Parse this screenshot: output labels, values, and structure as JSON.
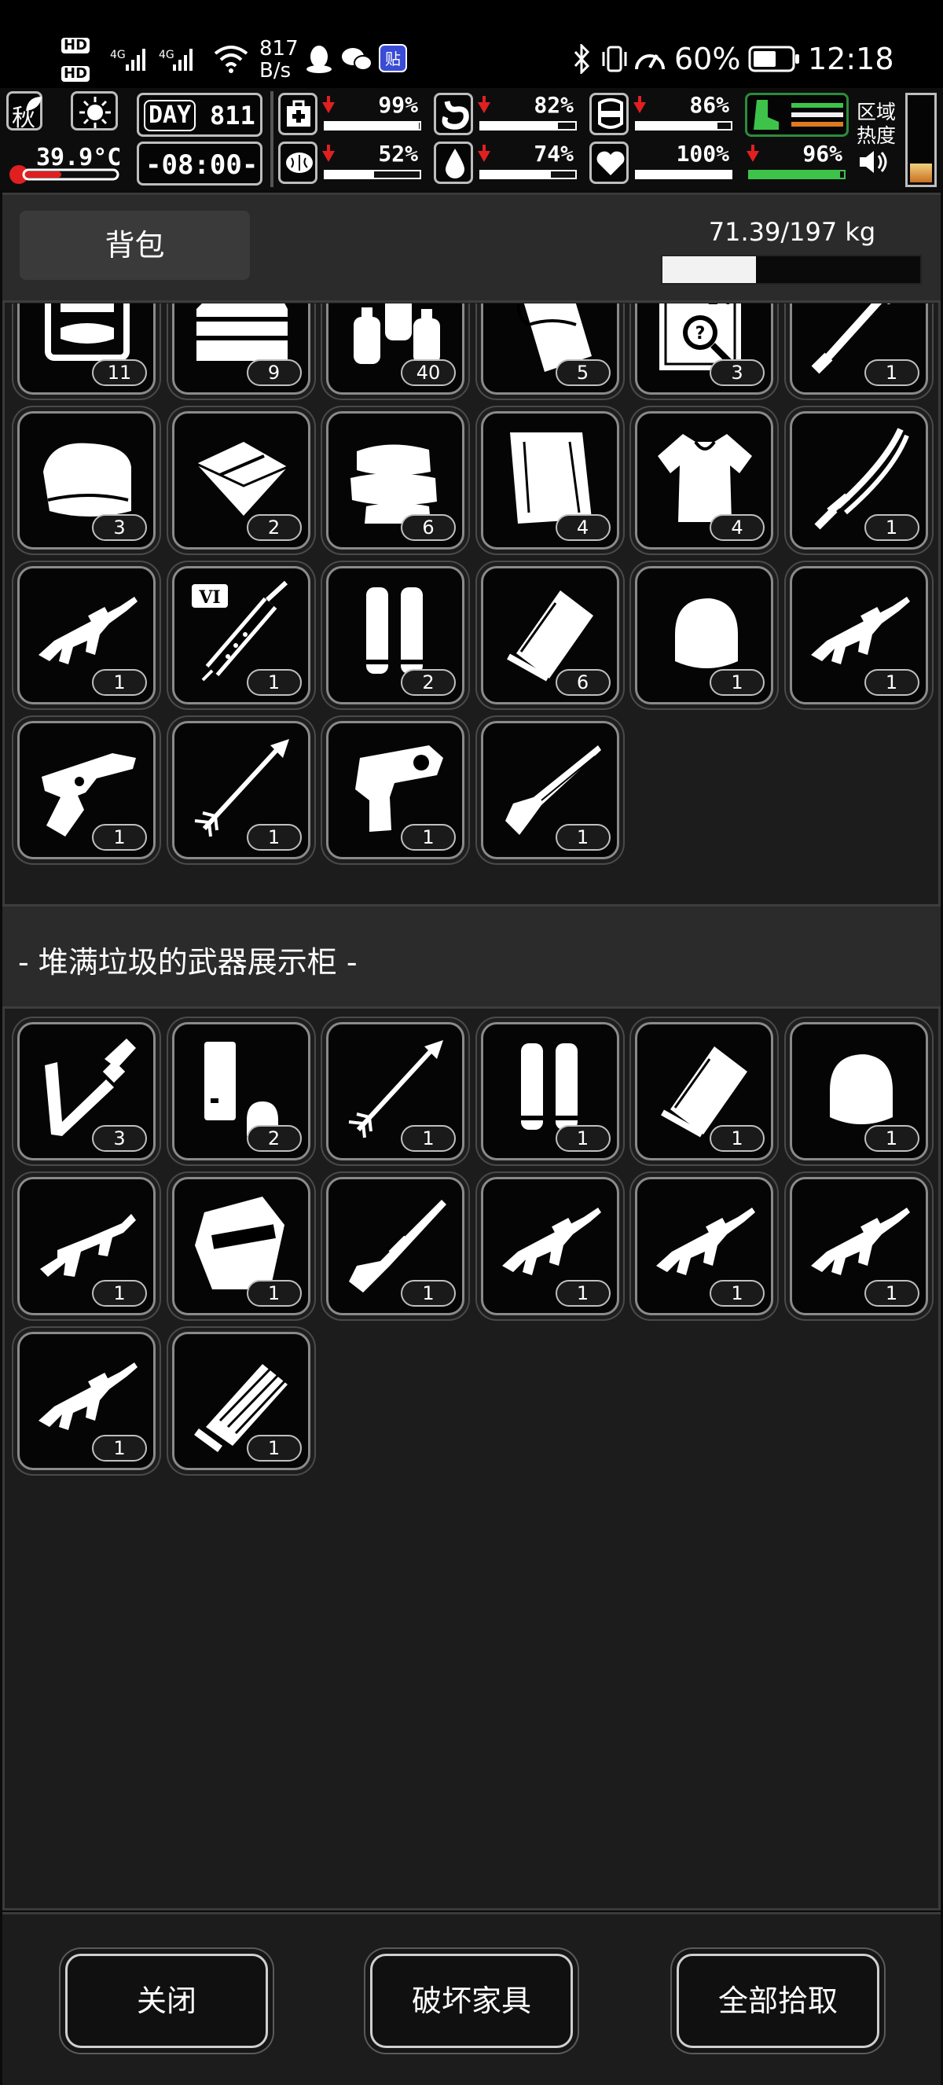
{
  "status_bar": {
    "hd1": "HD",
    "hd2": "HD",
    "net_speed_value": "817",
    "net_speed_unit": "B/s",
    "battery_pct": "60%",
    "time": "12:18"
  },
  "hud": {
    "season": "秋",
    "temperature": "39.9°C",
    "day_label": "DAY",
    "day_number": "811",
    "clock": "-08:00-",
    "region_heat_line1": "区域",
    "region_heat_line2": "热度",
    "stats": [
      {
        "name": "health",
        "icon": "medkit-icon",
        "value": "99%",
        "fraction": 0.99
      },
      {
        "name": "hunger",
        "icon": "stomach-icon",
        "value": "82%",
        "fraction": 0.82
      },
      {
        "name": "armor",
        "icon": "armor-icon",
        "value": "86%",
        "fraction": 0.86
      },
      {
        "name": "sanity",
        "icon": "brain-icon",
        "value": "52%",
        "fraction": 0.52
      },
      {
        "name": "thirst",
        "icon": "water-drop-icon",
        "value": "74%",
        "fraction": 0.74
      },
      {
        "name": "mood",
        "icon": "heart-icon",
        "value": "100%",
        "fraction": 1.0
      },
      {
        "name": "stamina",
        "icon": "boot-icon",
        "value": "96%",
        "fraction": 0.96
      }
    ]
  },
  "backpack": {
    "tab_label": "背包",
    "weight": "71.39/197 kg",
    "weight_fraction": 0.3624,
    "items": [
      {
        "icon": "toolkit-icon",
        "qty": "11"
      },
      {
        "icon": "toolbox-icon",
        "qty": "9"
      },
      {
        "icon": "spray-cans-icon",
        "qty": "40"
      },
      {
        "icon": "paper-roll-icon",
        "qty": "5"
      },
      {
        "icon": "manual-book-iv-icon",
        "qty": "3"
      },
      {
        "icon": "shovel-icon",
        "qty": "1"
      },
      {
        "icon": "blanket-icon",
        "qty": "3"
      },
      {
        "icon": "cloth-icon",
        "qty": "2"
      },
      {
        "icon": "clothes-pile-icon",
        "qty": "6"
      },
      {
        "icon": "towel-icon",
        "qty": "4"
      },
      {
        "icon": "shirt-icon",
        "qty": "4"
      },
      {
        "icon": "katana-icon",
        "qty": "1"
      },
      {
        "icon": "assault-rifle-icon",
        "qty": "1"
      },
      {
        "icon": "syringe-vi-icon",
        "qty": "1"
      },
      {
        "icon": "cartridges-icon",
        "qty": "2"
      },
      {
        "icon": "bullet-pack-icon",
        "qty": "6"
      },
      {
        "icon": "bullet-icon",
        "qty": "1"
      },
      {
        "icon": "assault-rifle-icon",
        "qty": "1"
      },
      {
        "icon": "revolver-icon",
        "qty": "1"
      },
      {
        "icon": "arrow-icon",
        "qty": "1"
      },
      {
        "icon": "flare-gun-icon",
        "qty": "1"
      },
      {
        "icon": "shotgun-icon",
        "qty": "1"
      }
    ]
  },
  "container": {
    "title": "- 堆满垃圾的武器展示柜 -",
    "items": [
      {
        "icon": "crowbar-bolt-icon",
        "qty": "3"
      },
      {
        "icon": "magazine-icon",
        "qty": "2"
      },
      {
        "icon": "arrow-icon",
        "qty": "1"
      },
      {
        "icon": "cartridges-icon",
        "qty": "1"
      },
      {
        "icon": "bullet-pack-icon",
        "qty": "1"
      },
      {
        "icon": "bullet-icon",
        "qty": "1"
      },
      {
        "icon": "smg-icon",
        "qty": "1"
      },
      {
        "icon": "riot-shield-icon",
        "qty": "1"
      },
      {
        "icon": "hunting-rifle-icon",
        "qty": "1"
      },
      {
        "icon": "assault-rifle-icon",
        "qty": "1"
      },
      {
        "icon": "assault-rifle-icon",
        "qty": "1"
      },
      {
        "icon": "assault-rifle-icon",
        "qty": "1"
      },
      {
        "icon": "assault-rifle-icon",
        "qty": "1"
      },
      {
        "icon": "minigun-icon",
        "qty": "1"
      }
    ]
  },
  "buttons": {
    "close": "关闭",
    "destroy": "破坏家具",
    "take_all": "全部拾取"
  }
}
